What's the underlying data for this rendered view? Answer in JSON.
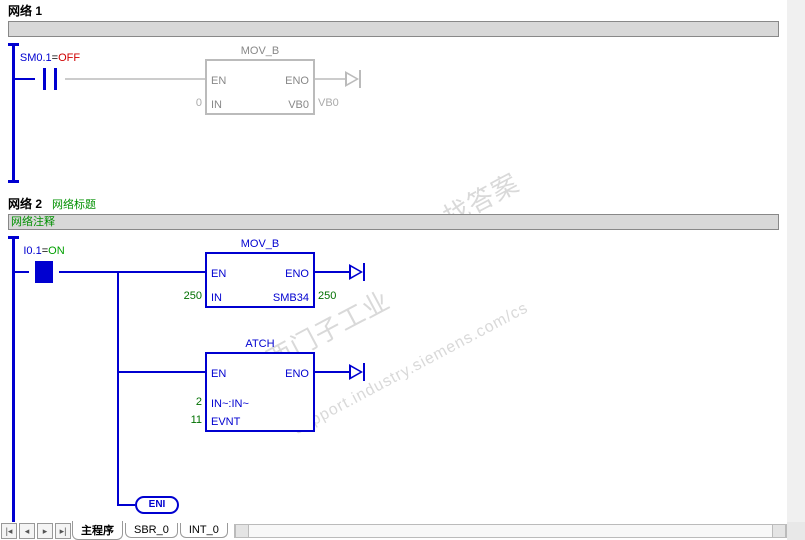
{
  "network1": {
    "title": "网络 1",
    "contact": {
      "addr": "SM0.1",
      "state": "OFF"
    },
    "block": {
      "name": "MOV_B",
      "en": "EN",
      "eno": "ENO",
      "in_label": "IN",
      "out_label": "VB0",
      "in_val": "0",
      "out_val": "VB0"
    }
  },
  "network2": {
    "title": "网络 2",
    "subtitle": "网络标题",
    "comment": "网络注释",
    "contact": {
      "addr": "I0.1",
      "state": "ON"
    },
    "block1": {
      "name": "MOV_B",
      "en": "EN",
      "eno": "ENO",
      "in_label": "IN",
      "out_label": "SMB34",
      "in_val": "250",
      "out_val": "250"
    },
    "block2": {
      "name": "ATCH",
      "en": "EN",
      "eno": "ENO",
      "p1_label": "IN~:IN~",
      "p1_val": "2",
      "p2_label": "EVNT",
      "p2_val": "11"
    },
    "eni": "ENI"
  },
  "tabs": {
    "t1": "主程序",
    "t2": "SBR_0",
    "t3": "INT_0"
  },
  "watermarks": {
    "w1": "找答案",
    "w2": "西门子工业",
    "w3": "support.industry.siemens.com/cs"
  }
}
